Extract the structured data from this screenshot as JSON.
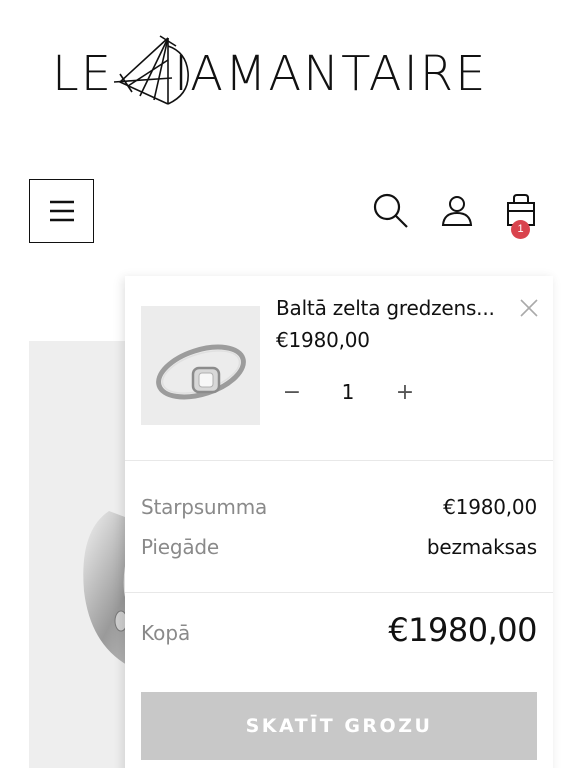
{
  "logo": {
    "prefix": "LE",
    "rest": "IAMANTAIRE"
  },
  "header": {
    "menu_icon": "hamburger-icon",
    "search_icon": "search-icon",
    "user_icon": "user-icon",
    "cart_icon": "shopping-bag-icon",
    "cart_count": "1"
  },
  "colors": {
    "badge": "#d9434d",
    "button_disabled": "#c8c8c8",
    "muted_text": "#8a8a8a"
  },
  "mini_cart": {
    "item": {
      "title": "Baltā zelta gredzens...",
      "price": "€1980,00",
      "quantity": "1",
      "minus_label": "−",
      "plus_label": "+",
      "remove_icon": "close-icon"
    },
    "subtotal_label": "Starpsumma",
    "subtotal_value": "€1980,00",
    "shipping_label": "Piegāde",
    "shipping_value": "bezmaksas",
    "total_label": "Kopā",
    "total_value": "€1980,00",
    "view_cart_label": "SKATĪT GROZU"
  }
}
